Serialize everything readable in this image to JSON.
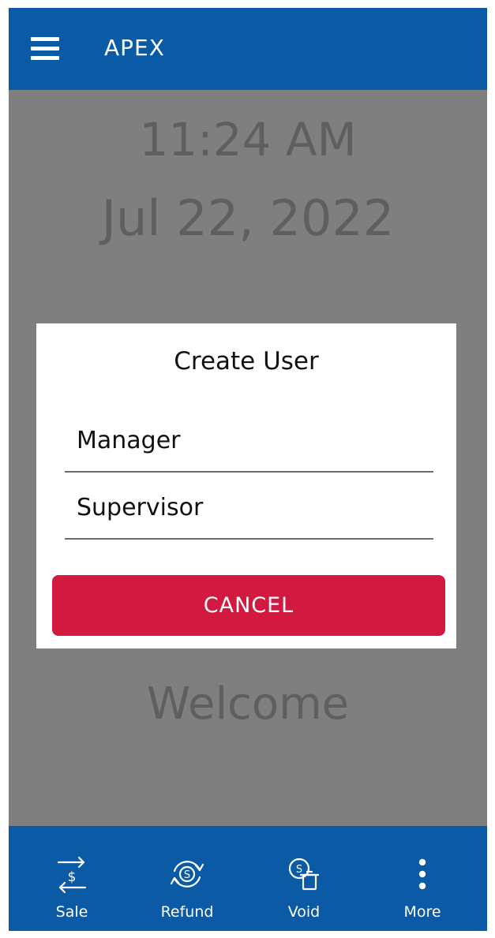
{
  "header": {
    "app_title": "APEX"
  },
  "clock": {
    "time": "11:24 AM",
    "date": "Jul 22, 2022"
  },
  "welcome_text": "Welcome",
  "dialog": {
    "title": "Create User",
    "options": [
      "Manager",
      "Supervisor"
    ],
    "cancel_label": "CANCEL"
  },
  "bottom_nav": {
    "items": [
      {
        "label": "Sale",
        "icon": "sale-transfer-icon"
      },
      {
        "label": "Refund",
        "icon": "refund-icon"
      },
      {
        "label": "Void",
        "icon": "void-icon"
      },
      {
        "label": "More",
        "icon": "more-vertical-icon"
      }
    ]
  },
  "colors": {
    "brand_blue": "#0a5aa6",
    "cancel_red": "#d2193f",
    "overlay_gray": "#7f7f7f",
    "muted_text": "#5f5f5f"
  }
}
